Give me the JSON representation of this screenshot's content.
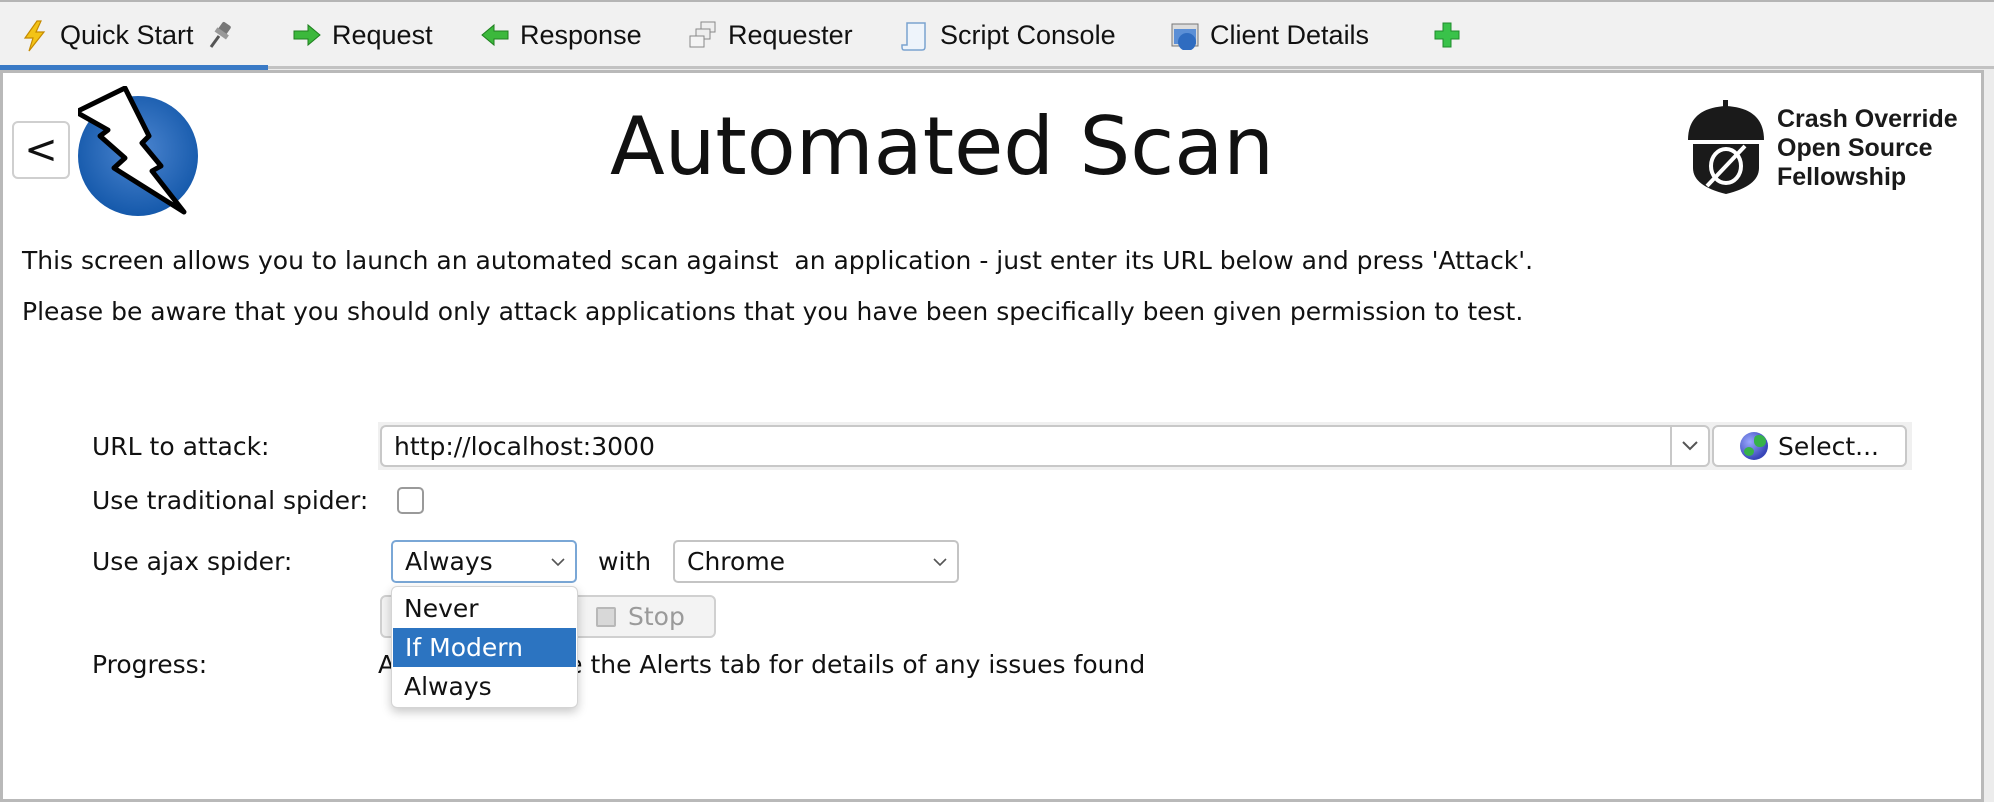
{
  "tabs": [
    {
      "label": "Quick Start",
      "icon": "lightning-icon",
      "active": true,
      "pinned": true
    },
    {
      "label": "Request",
      "icon": "arrow-right-icon",
      "active": false
    },
    {
      "label": "Response",
      "icon": "arrow-left-icon",
      "active": false
    },
    {
      "label": "Requester",
      "icon": "windows-icon",
      "active": false
    },
    {
      "label": "Script Console",
      "icon": "scroll-icon",
      "active": false
    },
    {
      "label": "Client Details",
      "icon": "browser-window-icon",
      "active": false
    }
  ],
  "add_tab_icon": "plus-icon",
  "colors": {
    "accent": "#3a7ac6",
    "selection": "#2c74c1",
    "logo_blue": "#1b5fb0"
  },
  "header": {
    "back_label": "<",
    "title": "Automated Scan",
    "sponsor_lines": [
      "Crash Override",
      "Open Source",
      "Fellowship"
    ]
  },
  "description": {
    "line1": "This screen allows you to launch an automated scan against  an application - just enter its URL below and press 'Attack'.",
    "line2": "Please be aware that you should only attack applications that you have been specifically been given permission to test."
  },
  "form": {
    "url_label": "URL to attack:",
    "url_value": "http://localhost:3000",
    "select_button": "Select...",
    "traditional_label": "Use traditional spider:",
    "traditional_checked": false,
    "ajax_label": "Use ajax spider:",
    "ajax_value": "Always",
    "with_label": "with",
    "browser_value": "Chrome",
    "stop_label": "Stop",
    "progress_label": "Progress:",
    "progress_text": "A             e - see the Alerts tab for details of any issues found"
  },
  "ajax_dropdown": {
    "options": [
      "Never",
      "If Modern",
      "Always"
    ],
    "highlighted": "If Modern"
  }
}
